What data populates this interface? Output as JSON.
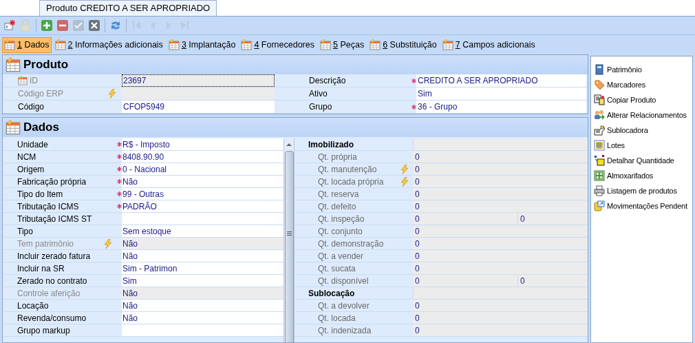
{
  "document_tab": {
    "title": "Produto CREDITO A SER APROPRIADO"
  },
  "toolbar": [
    {
      "kind": "new",
      "disabled": false
    },
    {
      "kind": "lock",
      "disabled": true
    },
    {
      "kind": "add",
      "disabled": false
    },
    {
      "kind": "remove",
      "disabled": false
    },
    {
      "kind": "confirm",
      "disabled": true
    },
    {
      "kind": "cancel",
      "disabled": false
    },
    {
      "kind": "refresh",
      "disabled": false
    },
    {
      "kind": "first",
      "disabled": true
    },
    {
      "kind": "prev",
      "disabled": true
    },
    {
      "kind": "next",
      "disabled": true
    },
    {
      "kind": "last",
      "disabled": true
    }
  ],
  "tabs": [
    {
      "key": "1",
      "label": "Dados",
      "selected": true
    },
    {
      "key": "2",
      "label": "Informações adicionais",
      "selected": false
    },
    {
      "key": "3",
      "label": "Implantação",
      "selected": false
    },
    {
      "key": "4",
      "label": "Fornecedores",
      "selected": false
    },
    {
      "key": "5",
      "label": "Peças",
      "selected": false
    },
    {
      "key": "6",
      "label": "Substituição",
      "selected": false
    },
    {
      "key": "7",
      "label": "Campos adicionais",
      "selected": false
    }
  ],
  "produto": {
    "title": "Produto",
    "rows": [
      {
        "label": "ID",
        "value": "23697",
        "disabled": true,
        "key_icon": true,
        "focused": true,
        "label_2": "Descrição",
        "value_2": "CREDITO A SER APROPRIADO",
        "required_2": true
      },
      {
        "label": "Código ERP",
        "value": "",
        "disabled": true,
        "lightning": true,
        "label_2": "Ativo",
        "value_2": "Sim",
        "required_2": false
      },
      {
        "label": "Código",
        "value": "CFOP5949",
        "disabled": false,
        "label_2": "Grupo",
        "value_2": "36 - Grupo",
        "required_2": true
      }
    ]
  },
  "dados": {
    "title": "Dados",
    "left_rows": [
      {
        "label": "Unidade",
        "value": "R$ - Imposto",
        "required": true,
        "disabled": false
      },
      {
        "label": "NCM",
        "value": "8408.90.90",
        "required": true,
        "disabled": false
      },
      {
        "label": "Origem",
        "value": "0 - Nacional",
        "required": true,
        "disabled": false
      },
      {
        "label": "Fabricação própria",
        "value": "Não",
        "required": true,
        "disabled": false
      },
      {
        "label": "Tipo do Item",
        "value": "99 - Outras",
        "required": true,
        "disabled": false
      },
      {
        "label": "Tributação ICMS",
        "value": "PADRÃO",
        "required": true,
        "disabled": false
      },
      {
        "label": "Tributação ICMS ST",
        "value": "",
        "required": false,
        "disabled": false
      },
      {
        "label": "Tipo",
        "value": "Sem estoque",
        "required": false,
        "disabled": false
      },
      {
        "label": "Tem patrimônio",
        "value": "Não",
        "required": false,
        "disabled": true,
        "lightning": true
      },
      {
        "label": "Incluir zerado fatura",
        "value": "Não",
        "required": false,
        "disabled": false
      },
      {
        "label": "Incluir na SR",
        "value": "Sim - Patrimon",
        "required": false,
        "disabled": false
      },
      {
        "label": "Zerado no contrato",
        "value": "Sim",
        "required": false,
        "disabled": false
      },
      {
        "label": "Controle aferição",
        "value": "Não",
        "required": false,
        "disabled": true
      },
      {
        "label": "Locação",
        "value": "Não",
        "required": false,
        "disabled": false
      },
      {
        "label": "Revenda/consumo",
        "value": "Não",
        "required": false,
        "disabled": false
      },
      {
        "label": "Grupo markup",
        "value": "",
        "required": false,
        "disabled": false
      }
    ],
    "right_rows": [
      {
        "kind": "group",
        "label": "Imobilizado"
      },
      {
        "kind": "field",
        "label": "Qt. própria",
        "value": "0"
      },
      {
        "kind": "field",
        "label": "Qt. manutenção",
        "value": "0",
        "lightning": true
      },
      {
        "kind": "field",
        "label": "Qt. locada própria",
        "value": "0",
        "lightning": true
      },
      {
        "kind": "field",
        "label": "Qt. reserva",
        "value": "0"
      },
      {
        "kind": "field",
        "label": "Qt. defeito",
        "value": "0"
      },
      {
        "kind": "field",
        "label": "Qt. inspeção",
        "value": "0",
        "value_2": "0"
      },
      {
        "kind": "field",
        "label": "Qt. conjunto",
        "value": "0"
      },
      {
        "kind": "field",
        "label": "Qt. demonstração",
        "value": "0"
      },
      {
        "kind": "field",
        "label": "Qt. a vender",
        "value": "0"
      },
      {
        "kind": "field",
        "label": "Qt. sucata",
        "value": "0"
      },
      {
        "kind": "field",
        "label": "Qt. disponível",
        "value": "0",
        "value_2": "0"
      },
      {
        "kind": "group",
        "label": "Sublocação"
      },
      {
        "kind": "field",
        "label": "Qt. a devolver",
        "value": "0"
      },
      {
        "kind": "field",
        "label": "Qt. locada",
        "value": "0"
      },
      {
        "kind": "field",
        "label": "Qt. indenizada",
        "value": "0"
      }
    ]
  },
  "actions": [
    {
      "kind": "book",
      "label": "Patrimônio"
    },
    {
      "kind": "tag",
      "label": "Marcadores"
    },
    {
      "kind": "copy",
      "label": "Copiar Produto"
    },
    {
      "kind": "people",
      "label": "Alterar Relacionamentos"
    },
    {
      "kind": "hand",
      "label": "Sublocadora"
    },
    {
      "kind": "grid",
      "label": "Lotes"
    },
    {
      "kind": "detail",
      "label": "Detalhar Quantidade"
    },
    {
      "kind": "warehouse",
      "label": "Almoxarifados"
    },
    {
      "kind": "printer",
      "label": "Listagem de produtos"
    },
    {
      "kind": "moves",
      "label": "Movimentações Pendent"
    }
  ]
}
